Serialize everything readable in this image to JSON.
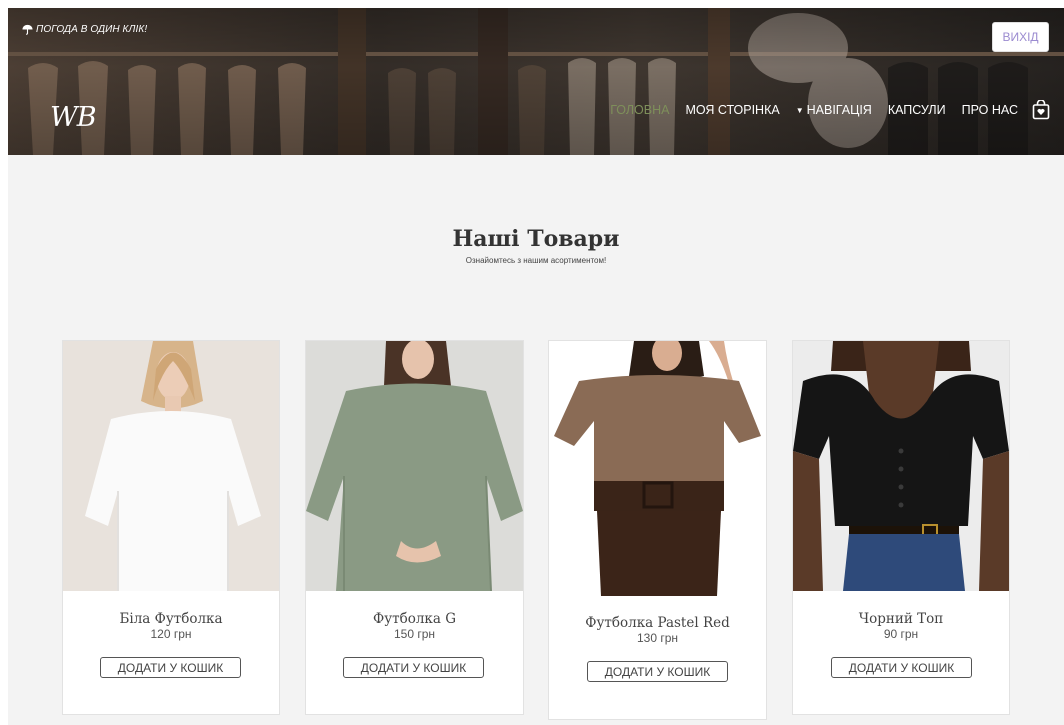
{
  "header": {
    "weather_link": "ПОГОДА В ОДИН КЛІК!",
    "logout_label": "ВИХІД",
    "logo_text": "WB",
    "nav": [
      {
        "label": "ГОЛОВНА",
        "active": true
      },
      {
        "label": "МОЯ СТОРІНКА",
        "active": false
      },
      {
        "label": "НАВІГАЦІЯ",
        "active": false,
        "dropdown": true
      },
      {
        "label": "КАПСУЛИ",
        "active": false
      },
      {
        "label": "ПРО НАС",
        "active": false
      }
    ],
    "cart_icon": "shopping-bag-heart-icon"
  },
  "section": {
    "title": "Наші Товари",
    "subtitle": "Ознайомтесь з нашим асортиментом!"
  },
  "products": [
    {
      "name": "Біла Футболка",
      "price": "120 грн",
      "button": "ДОДАТИ У КОШИК"
    },
    {
      "name": "Футболка G",
      "price": "150 грн",
      "button": "ДОДАТИ У КОШИК"
    },
    {
      "name": "Футболка Pastel Red",
      "price": "130 грн",
      "button": "ДОДАТИ У КОШИК"
    },
    {
      "name": "Чорний Топ",
      "price": "90 грн",
      "button": "ДОДАТИ У КОШИК"
    }
  ],
  "colors": {
    "active_nav": "#7e8f5a",
    "logout_text": "#9b8bd0",
    "page_bg": "#f3f3f3"
  }
}
